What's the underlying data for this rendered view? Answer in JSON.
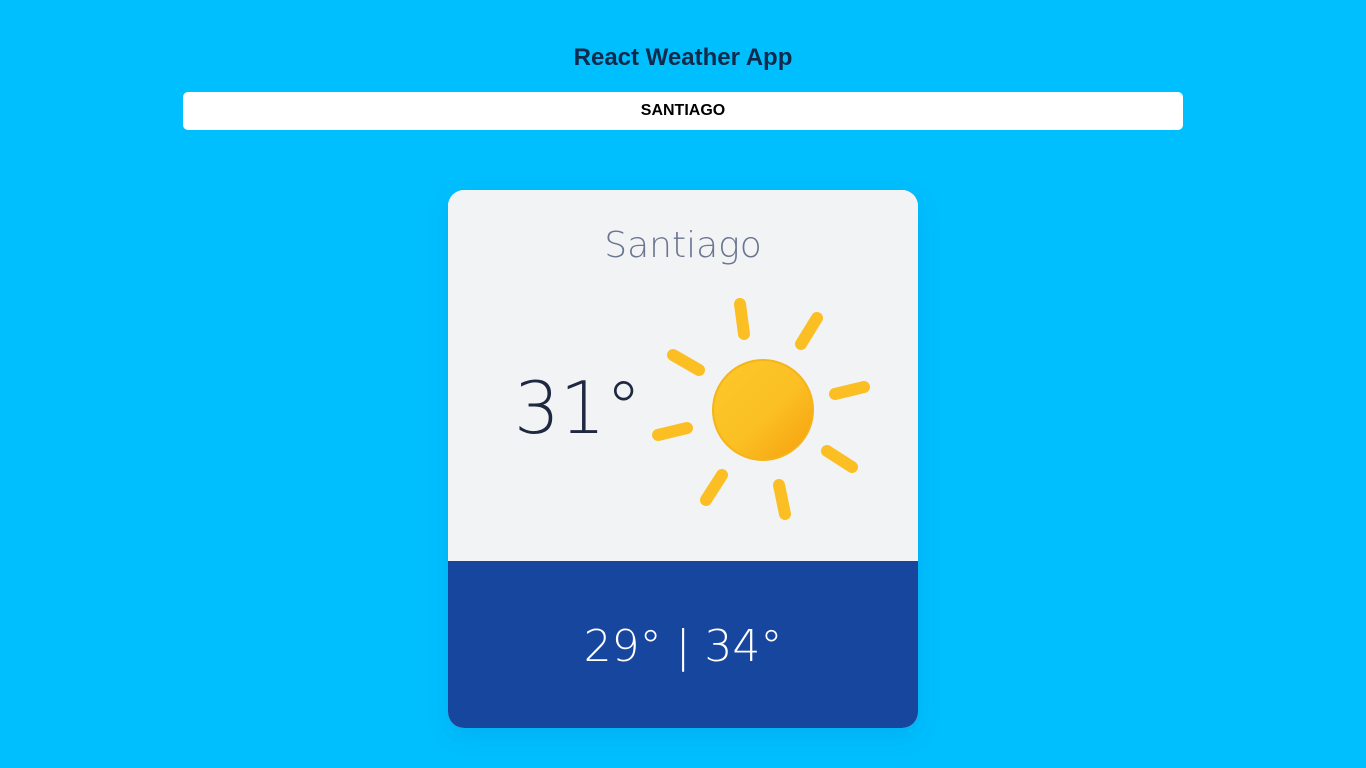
{
  "app": {
    "title": "React Weather App"
  },
  "search": {
    "value": "SANTIAGO"
  },
  "weather": {
    "city": "Santiago",
    "current_temp": "31°",
    "condition_icon": "sun-icon",
    "min_temp": "29°",
    "separator": "|",
    "max_temp": "34°"
  },
  "colors": {
    "background": "#00bfff",
    "card_top": "#f2f3f5",
    "card_bottom": "#17469e",
    "sun": "#fbbf24"
  }
}
